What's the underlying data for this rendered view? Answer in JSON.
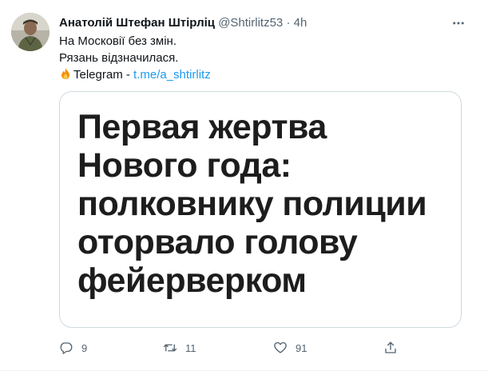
{
  "tweet": {
    "author_name": "Анатолій Штефан Штірліц",
    "handle": "@Shtirlitz53",
    "separator": "·",
    "time": "4h",
    "lines": [
      "На Московії без змін.",
      "Рязань відзначилася."
    ],
    "telegram_label": "Telegram - ",
    "telegram_link": "t.me/a_shtirlitz",
    "image_headline": [
      "Первая жертва",
      "Нового года:",
      "полковнику полиции",
      "оторвало голову",
      "фейерверком"
    ],
    "actions": {
      "reply_count": "9",
      "retweet_count": "11",
      "like_count": "91"
    }
  },
  "icons": {
    "more": "more-horizontal-icon",
    "fire": "fire-emoji-icon",
    "reply": "reply-icon",
    "retweet": "retweet-icon",
    "like": "heart-icon",
    "share": "share-icon"
  },
  "colors": {
    "link": "#1d9bf0",
    "secondary_text": "#536471",
    "primary_text": "#0f1419",
    "border": "#cfd9de"
  }
}
